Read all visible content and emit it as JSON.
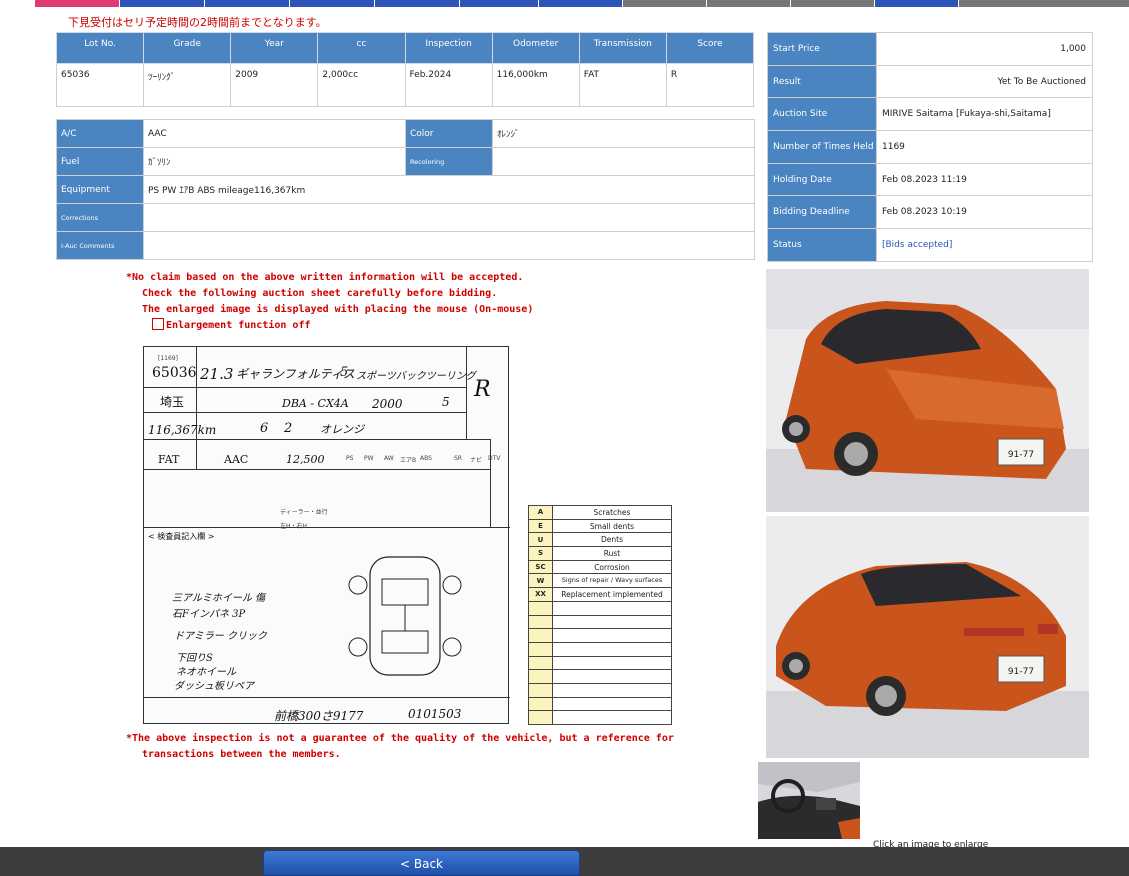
{
  "top_nav": {
    "notice": "下見受付はセリ予定時間の2時間前までとなります。"
  },
  "vehicle_header": {
    "columns": [
      "Lot No.",
      "Grade",
      "Year",
      "cc",
      "Inspection",
      "Odometer",
      "Transmission",
      "Score"
    ],
    "values": [
      "65036",
      "ﾂｰﾘﾝｸﾞ",
      "2009",
      "2,000cc",
      "Feb.2024",
      "116,000km",
      "FAT",
      "R"
    ]
  },
  "specs": {
    "ac_label": "A/C",
    "ac_value": "AAC",
    "color_label": "Color",
    "color_value": "ｵﾚﾝｼﾞ",
    "fuel_label": "Fuel",
    "fuel_value": "ｶﾞｿﾘﾝ",
    "recoloring_label": "Recoloring",
    "recoloring_value": "",
    "equipment_label": "Equipment",
    "equipment_value": "PS PW ｴｱB ABS mileage116,367km",
    "corrections_label": "Corrections",
    "corrections_value": "",
    "comments_label": "I-Auc Comments",
    "comments_value": ""
  },
  "auction_info": {
    "start_price_label": "Start Price",
    "start_price": "1,000",
    "result_label": "Result",
    "result": "Yet To Be Auctioned",
    "site_label": "Auction Site",
    "site": "MIRIVE Saitama [Fukaya-shi,Saitama]",
    "times_label": "Number of Times Held",
    "times": "1169",
    "holding_label": "Holding Date",
    "holding": "Feb 08.2023 11:19",
    "deadline_label": "Bidding Deadline",
    "deadline": "Feb 08.2023 10:19",
    "status_label": "Status",
    "status": "[Bids accepted]"
  },
  "notices": {
    "line1": "*No claim based on the above written information will be accepted.",
    "line2": "Check the following auction sheet carefully before bidding.",
    "line3": "The enlarged image is displayed with placing the mouse (On-mouse)",
    "enlarge_label": "Enlargement function off",
    "footer1": "*The above inspection is not a guarantee of the quality of the vehicle, but a reference for",
    "footer2": "transactions between the members."
  },
  "auction_sheet": {
    "held": "[1169]",
    "lot": "65036",
    "year": "21.3",
    "model_name": "ギャランフォルティス",
    "doors": "5",
    "grade": "スポーツバックツーリング",
    "region": "埼玉",
    "chassis": "DBA - CX4A",
    "displacement": "2000",
    "seats": "5",
    "score": "R",
    "mileage": "116,367km",
    "month": "6",
    "day": "2",
    "color": "オレンジ",
    "shift": "FAT",
    "aircon": "AAC",
    "recycle": "12,500",
    "options": [
      "PS",
      "PW",
      "AW",
      "エアB",
      "ABS",
      "SR",
      "ナビ",
      "DTV"
    ],
    "notes_heading": "< 検査員記入欄 >",
    "notes": [
      "三アルミホイール 傷",
      "石Fインパネ 3P",
      "ドアミラー クリック",
      "下回りS",
      "ネオホイール",
      "ダッシュ板リペア"
    ],
    "plate": "前橋300さ9177",
    "doc_no": "0101503",
    "dealer_label": "ディーラー・並行",
    "handle_label": "左H・右H"
  },
  "legend": {
    "rows": [
      {
        "code": "A",
        "desc": "Scratches"
      },
      {
        "code": "E",
        "desc": "Small dents"
      },
      {
        "code": "U",
        "desc": "Dents"
      },
      {
        "code": "S",
        "desc": "Rust"
      },
      {
        "code": "SC",
        "desc": "Corrosion"
      },
      {
        "code": "W",
        "desc": "Signs of repair / Wavy surfaces"
      },
      {
        "code": "XX",
        "desc": "Replacement implemented"
      }
    ]
  },
  "photos": {
    "front_plate": "91-77",
    "rear_plate": "91-77",
    "caption": "Click an image to enlarge"
  },
  "footer": {
    "back_label": "< Back"
  },
  "colors": {
    "header_blue": "#4a85c1",
    "notice_red": "#d00000",
    "legend_yellow": "#fbf4bf",
    "car_orange": "#c9551d"
  }
}
